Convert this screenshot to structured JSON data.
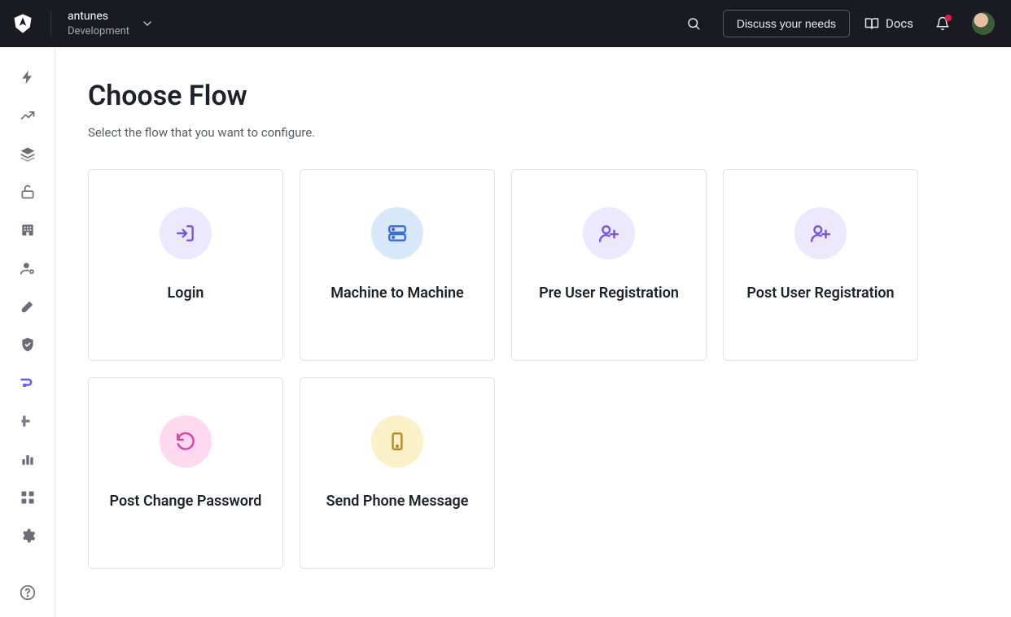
{
  "header": {
    "tenant_name": "antunes",
    "tenant_env": "Development",
    "discuss_label": "Discuss your needs",
    "docs_label": "Docs"
  },
  "page": {
    "title": "Choose Flow",
    "subtitle": "Select the flow that you want to configure."
  },
  "flows": [
    {
      "label": "Login",
      "icon": "log-in",
      "circle": "purple"
    },
    {
      "label": "Machine to Machine",
      "icon": "server",
      "circle": "blue"
    },
    {
      "label": "Pre User Registration",
      "icon": "user-plus",
      "circle": "purple"
    },
    {
      "label": "Post User Registration",
      "icon": "user-plus",
      "circle": "purple"
    },
    {
      "label": "Post Change Password",
      "icon": "rotate-ccw",
      "circle": "pink"
    },
    {
      "label": "Send Phone Message",
      "icon": "smartphone",
      "circle": "yellow"
    }
  ],
  "sidebar": {
    "items": [
      {
        "id": "getting-started",
        "icon": "zap"
      },
      {
        "id": "activity",
        "icon": "trend"
      },
      {
        "id": "applications",
        "icon": "layers"
      },
      {
        "id": "authentication",
        "icon": "unlock"
      },
      {
        "id": "organizations",
        "icon": "building"
      },
      {
        "id": "users",
        "icon": "user-cog"
      },
      {
        "id": "branding",
        "icon": "brush"
      },
      {
        "id": "security",
        "icon": "shield"
      },
      {
        "id": "actions",
        "icon": "flow",
        "active": true
      },
      {
        "id": "pipelines",
        "icon": "pipe"
      },
      {
        "id": "monitoring",
        "icon": "chart"
      },
      {
        "id": "marketplace",
        "icon": "grid"
      },
      {
        "id": "settings",
        "icon": "gear"
      }
    ]
  }
}
